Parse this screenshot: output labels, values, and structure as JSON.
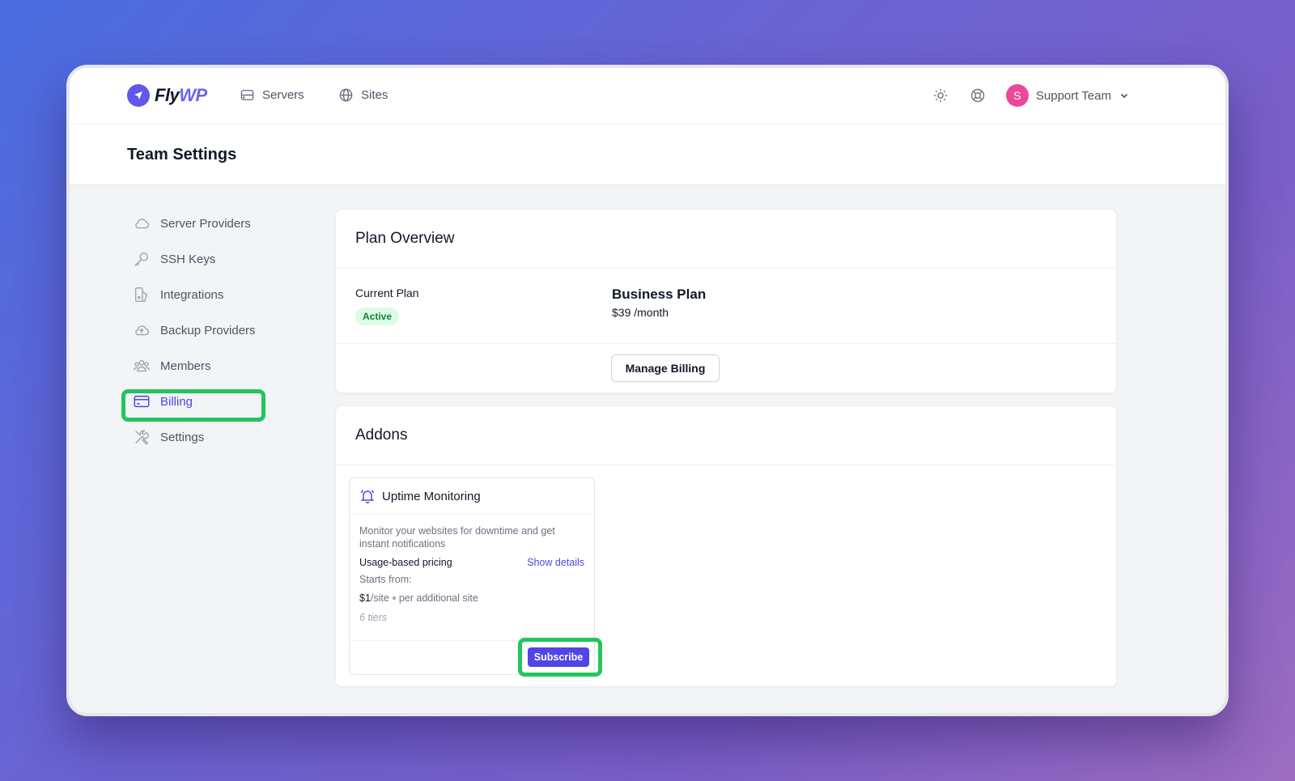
{
  "app": {
    "logo_fly": "Fly",
    "logo_wp": "WP"
  },
  "nav": {
    "servers": "Servers",
    "sites": "Sites"
  },
  "user": {
    "avatar_initial": "S",
    "team_name": "Support Team"
  },
  "page": {
    "title": "Team Settings"
  },
  "sidebar": {
    "items": [
      {
        "label": "Server Providers",
        "icon": "cloud-icon"
      },
      {
        "label": "SSH Keys",
        "icon": "key-icon"
      },
      {
        "label": "Integrations",
        "icon": "integrations-icon"
      },
      {
        "label": "Backup Providers",
        "icon": "cloud-upload-icon"
      },
      {
        "label": "Members",
        "icon": "users-icon"
      },
      {
        "label": "Billing",
        "icon": "credit-card-icon",
        "active": true
      },
      {
        "label": "Settings",
        "icon": "tools-icon"
      }
    ]
  },
  "plan": {
    "title": "Plan Overview",
    "current_label": "Current Plan",
    "status": "Active",
    "plan_name": "Business Plan",
    "price": "$39 /month",
    "manage_button": "Manage Billing"
  },
  "addons": {
    "title": "Addons",
    "items": [
      {
        "name": "Uptime Monitoring",
        "description": "Monitor your websites for downtime and get instant notifications",
        "pricing_label": "Usage-based pricing",
        "details_link": "Show details",
        "starts_from": "Starts from:",
        "price": "$1",
        "price_unit": "/site",
        "price_note": "per additional site",
        "tiers": "6 tiers",
        "subscribe_button": "Subscribe"
      }
    ]
  },
  "colors": {
    "accent": "#4f46e5",
    "highlight": "#22c55e",
    "badge_bg": "#dcfce7",
    "badge_text": "#15803d",
    "avatar": "#ec4899"
  }
}
